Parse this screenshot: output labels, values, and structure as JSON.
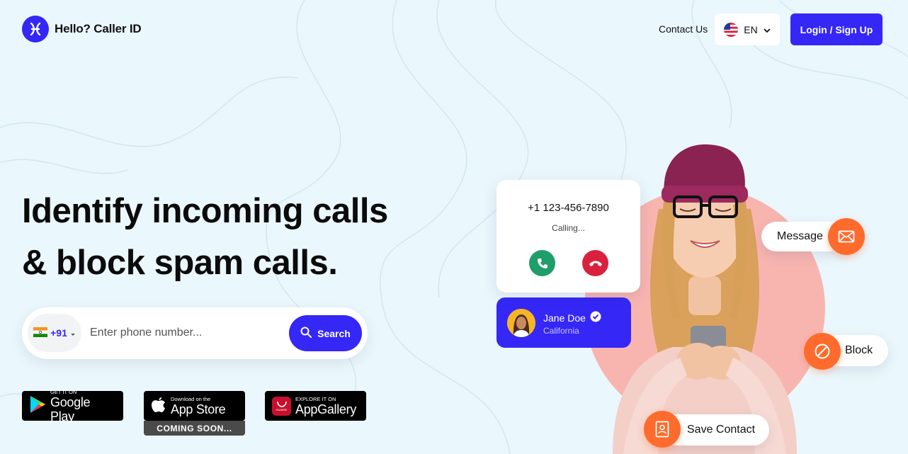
{
  "brand": {
    "name": "Hello? Caller ID",
    "accent": "#3527f5",
    "orange": "#fe6b2c"
  },
  "nav": {
    "contact_label": "Contact Us",
    "language": "EN",
    "login_label": "Login / Sign Up"
  },
  "hero": {
    "headline_line1": "Identify incoming calls",
    "headline_line2": "& block spam calls.",
    "search": {
      "country_code": "+91",
      "placeholder": "Enter phone number...",
      "button_label": "Search"
    }
  },
  "stores": {
    "google": {
      "small": "GET IT ON",
      "big": "Google Play"
    },
    "apple": {
      "small": "Download on the",
      "big": "App Store",
      "note": "COMING SOON..."
    },
    "huawei": {
      "small": "EXPLORE IT ON",
      "big": "AppGallery",
      "logo_text": "HUAWEI"
    }
  },
  "illustration": {
    "call": {
      "number": "+1 123-456-7890",
      "status": "Calling..."
    },
    "caller": {
      "name": "Jane Doe",
      "location": "California"
    },
    "actions": {
      "message": "Message",
      "block": "Block",
      "save_contact": "Save Contact"
    }
  }
}
